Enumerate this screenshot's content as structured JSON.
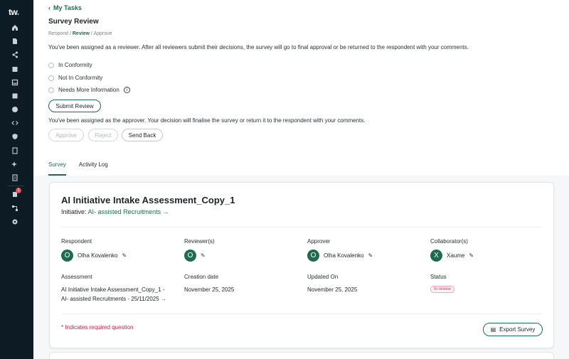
{
  "sidebar": {
    "logo_text": "tw",
    "logo_dot": ".",
    "notification_count": "1"
  },
  "header": {
    "back_label": "My Tasks",
    "title": "Survey Review",
    "breadcrumb": {
      "step1": "Respond",
      "sep1": " / ",
      "step2": "Review",
      "sep2": " / ",
      "step3": "Approve"
    }
  },
  "review": {
    "intro": "You've been assigned as a reviewer. After all reviewers submit their decisions, the survey will go to final approval or be returned to the respondent with your comments.",
    "options": [
      "In Conformity",
      "Not In Conformity",
      "Needs More Information"
    ],
    "submit_label": "Submit Review"
  },
  "approval": {
    "note": "You've been assigned as the approver. Your decision will finalise the survey or return it to the respondent with your comments.",
    "approve_label": "Approve",
    "reject_label": "Reject",
    "send_back_label": "Send Back"
  },
  "tabs": [
    "Survey",
    "Activity Log"
  ],
  "card": {
    "title": "AI Initiative Intake Assessment_Copy_1",
    "initiative_label": "Initiative:",
    "initiative_link": "AI- assisted Recruitments",
    "respondent_label": "Respondent",
    "respondent_initial": "O",
    "respondent_name": "Olha Kovalenko",
    "reviewers_label": "Reviewer(s)",
    "reviewer_initial": "O",
    "approver_label": "Approver",
    "approver_initial": "O",
    "approver_name": "Olha Kovalenko",
    "collaborators_label": "Collaborator(s)",
    "collaborator_initial": "X",
    "collaborator_name": "Xaume",
    "assessment_label": "Assessment",
    "assessment_line1": "AI Initiative Intake Assessment_Copy_1 -",
    "assessment_line2": "AI- assisted Recruitments - 25/11/2025",
    "creation_label": "Creation date",
    "creation_value": "November 25, 2025",
    "updated_label": "Updated On",
    "updated_value": "November 25, 2025",
    "status_label": "Status",
    "status_value": "In review",
    "required_note": "* Indicates required question",
    "export_label": "Export Survey"
  },
  "colors": {
    "sidebar_bg": "#0d1b24",
    "accent_green": "#1f6b4f",
    "required_red": "#c0264a"
  }
}
